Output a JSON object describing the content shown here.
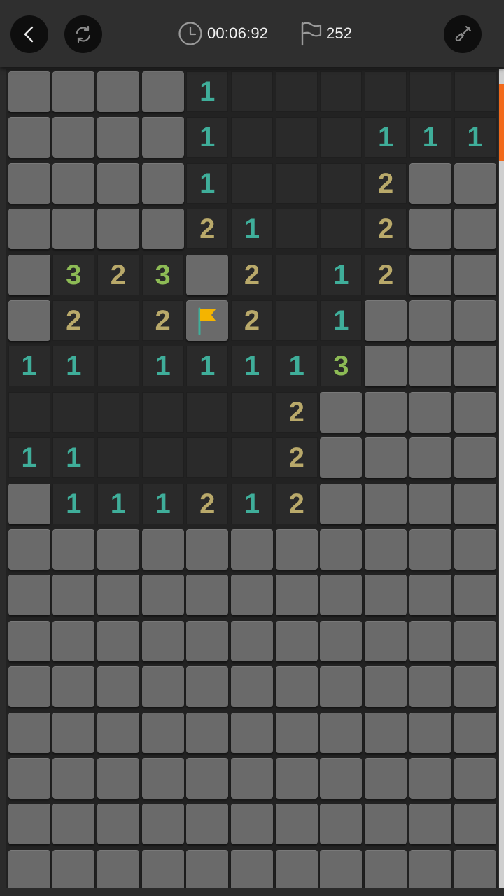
{
  "header": {
    "timer": "00:06:92",
    "flags_left": "252",
    "icons": {
      "back": "chevron-left-icon",
      "restart": "refresh-icon",
      "timer": "clock-icon",
      "flags": "flag-outline-icon",
      "tool": "shovel-icon"
    }
  },
  "board": {
    "columns": 11,
    "visible_rows": 18,
    "rows": [
      [
        "H",
        "H",
        "H",
        "H",
        "1",
        "0",
        "0",
        "0",
        "0",
        "0",
        "0"
      ],
      [
        "H",
        "H",
        "H",
        "H",
        "1",
        "0",
        "0",
        "0",
        "1",
        "1",
        "1"
      ],
      [
        "H",
        "H",
        "H",
        "H",
        "1",
        "0",
        "0",
        "0",
        "2",
        "H",
        "H"
      ],
      [
        "H",
        "H",
        "H",
        "H",
        "2",
        "1",
        "0",
        "0",
        "2",
        "H",
        "H"
      ],
      [
        "H",
        "3",
        "2",
        "3",
        "H",
        "2",
        "0",
        "1",
        "2",
        "H",
        "H"
      ],
      [
        "H",
        "2",
        "0",
        "2",
        "F",
        "2",
        "0",
        "1",
        "H",
        "H",
        "H"
      ],
      [
        "1",
        "1",
        "0",
        "1",
        "1",
        "1",
        "1",
        "3",
        "H",
        "H",
        "H"
      ],
      [
        "0",
        "0",
        "0",
        "0",
        "0",
        "0",
        "2",
        "H",
        "H",
        "H",
        "H"
      ],
      [
        "1",
        "1",
        "0",
        "0",
        "0",
        "0",
        "2",
        "H",
        "H",
        "H",
        "H"
      ],
      [
        "H",
        "1",
        "1",
        "1",
        "2",
        "1",
        "2",
        "H",
        "H",
        "H",
        "H"
      ],
      [
        "H",
        "H",
        "H",
        "H",
        "H",
        "H",
        "H",
        "H",
        "H",
        "H",
        "H"
      ],
      [
        "H",
        "H",
        "H",
        "H",
        "H",
        "H",
        "H",
        "H",
        "H",
        "H",
        "H"
      ],
      [
        "H",
        "H",
        "H",
        "H",
        "H",
        "H",
        "H",
        "H",
        "H",
        "H",
        "H"
      ],
      [
        "H",
        "H",
        "H",
        "H",
        "H",
        "H",
        "H",
        "H",
        "H",
        "H",
        "H"
      ],
      [
        "H",
        "H",
        "H",
        "H",
        "H",
        "H",
        "H",
        "H",
        "H",
        "H",
        "H"
      ],
      [
        "H",
        "H",
        "H",
        "H",
        "H",
        "H",
        "H",
        "H",
        "H",
        "H",
        "H"
      ],
      [
        "H",
        "H",
        "H",
        "H",
        "H",
        "H",
        "H",
        "H",
        "H",
        "H",
        "H"
      ],
      [
        "H",
        "H",
        "H",
        "H",
        "H",
        "H",
        "H",
        "H",
        "H",
        "H",
        "H"
      ]
    ]
  },
  "colors": {
    "background": "#2b2b2b",
    "hidden_tile": "#6a6a6a",
    "open_tile": "#2a2a2a",
    "number_1": "#3fae9a",
    "number_2": "#b9a96a",
    "number_3": "#8dbb55",
    "flag": "#f4b400",
    "scroll_thumb": "#f26a1b"
  },
  "scroll": {
    "position_fraction": 0.02
  }
}
